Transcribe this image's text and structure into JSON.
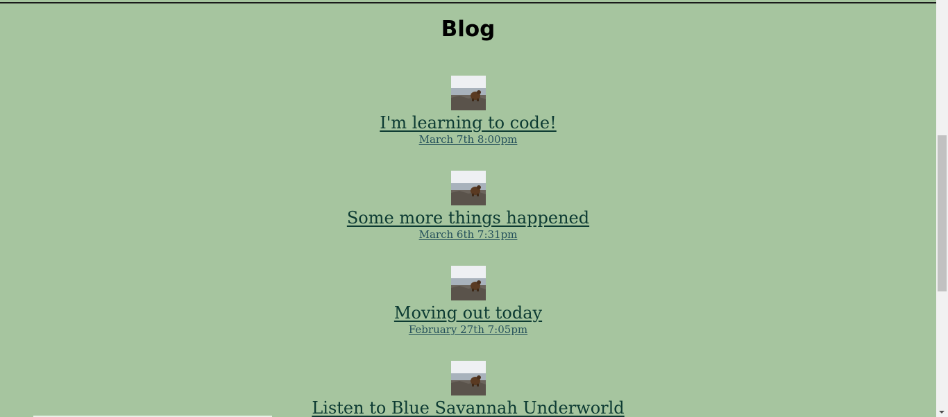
{
  "page": {
    "heading": "Blog"
  },
  "posts": [
    {
      "title": "I'm learning to code!",
      "date": "March 7th 8:00pm",
      "thumbnail_icon": "beaver-photo"
    },
    {
      "title": "Some more things happened",
      "date": "March 6th 7:31pm",
      "thumbnail_icon": "beaver-photo"
    },
    {
      "title": "Moving out today",
      "date": "February 27th 7:05pm",
      "thumbnail_icon": "beaver-photo"
    },
    {
      "title": "Listen to Blue Savannah Underworld",
      "date": "",
      "thumbnail_icon": "beaver-photo"
    }
  ],
  "colors": {
    "background": "#a6c59f",
    "link": "#0c3a32",
    "date_link": "#24505a"
  }
}
